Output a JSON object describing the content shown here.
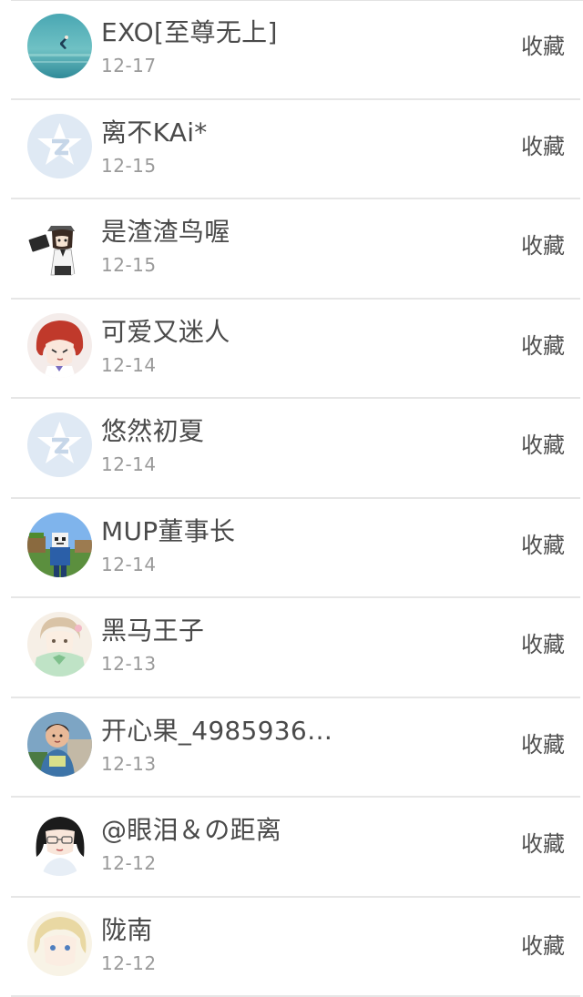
{
  "items": [
    {
      "name": "EXO[至尊无上]",
      "date": "12-17",
      "action": "收藏",
      "avatar": "ocean-dancer-avatar"
    },
    {
      "name": "离不KAi*",
      "date": "12-15",
      "action": "收藏",
      "avatar": "qq-default-avatar"
    },
    {
      "name": "是渣渣鸟喔",
      "date": "12-15",
      "action": "收藏",
      "avatar": "anime-character-avatar"
    },
    {
      "name": "可爱又迷人",
      "date": "12-14",
      "action": "收藏",
      "avatar": "redhead-anime-avatar"
    },
    {
      "name": "悠然初夏",
      "date": "12-14",
      "action": "收藏",
      "avatar": "qq-default-avatar"
    },
    {
      "name": "MUP董事长",
      "date": "12-14",
      "action": "收藏",
      "avatar": "minecraft-skin-avatar"
    },
    {
      "name": "黑马王子",
      "date": "12-13",
      "action": "收藏",
      "avatar": "anime-girl-green-avatar"
    },
    {
      "name": "开心果_4985936…",
      "date": "12-13",
      "action": "收藏",
      "avatar": "child-photo-avatar"
    },
    {
      "name": "@眼泪＆の距离",
      "date": "12-12",
      "action": "收藏",
      "avatar": "glasses-girl-avatar"
    },
    {
      "name": "陇南",
      "date": "12-12",
      "action": "收藏",
      "avatar": "blonde-anime-avatar"
    }
  ]
}
